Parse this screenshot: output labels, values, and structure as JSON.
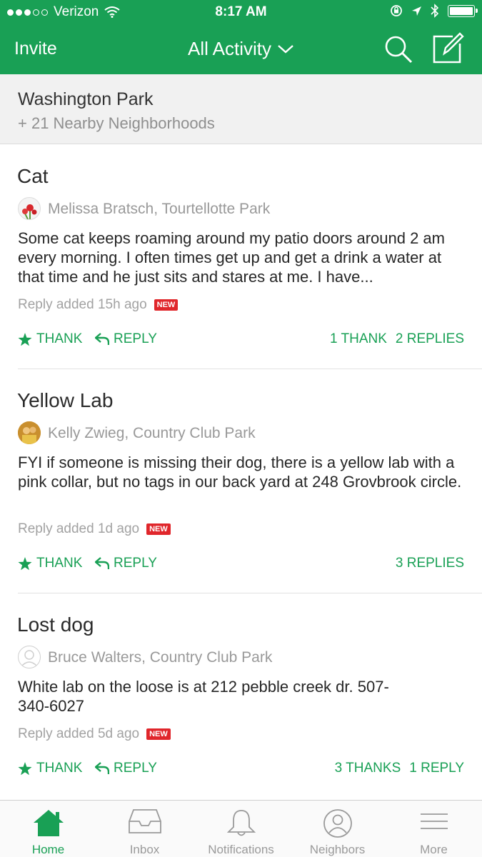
{
  "status_bar": {
    "carrier": "Verizon",
    "time": "8:17 AM",
    "battery_level": 1.0
  },
  "nav": {
    "invite_label": "Invite",
    "title": "All Activity",
    "search_icon": "search-icon",
    "compose_icon": "compose-icon"
  },
  "neighborhood": {
    "name": "Washington Park",
    "nearby": "+ 21 Nearby Neighborhoods"
  },
  "posts": [
    {
      "title": "Cat",
      "author": "Melissa Bratsch, Tourtellotte Park",
      "body": "Some cat keeps roaming around my patio doors around 2 am every morning. I often times get up and get a drink a water at that time and he just sits and stares at me. I have...",
      "meta": "Reply added 15h ago",
      "badge": "NEW",
      "thank_label": "THANK",
      "reply_label": "REPLY",
      "thanks_count": "1 THANK",
      "replies_count": "2 REPLIES"
    },
    {
      "title": "Yellow Lab",
      "author": "Kelly Zwieg, Country Club Park",
      "body": "FYI if someone is missing their dog, there is a yellow lab with a pink collar, but no tags in our back yard at 248 Grovbrook circle.",
      "meta": "Reply added 1d ago",
      "badge": "NEW",
      "thank_label": "THANK",
      "reply_label": "REPLY",
      "thanks_count": "",
      "replies_count": "3 REPLIES"
    },
    {
      "title": "Lost dog",
      "author": "Bruce Walters, Country Club Park",
      "body": "White lab on the loose is at 212 pebble creek dr. 507-340-6027",
      "meta": "Reply added 5d ago",
      "badge": "NEW",
      "thank_label": "THANK",
      "reply_label": "REPLY",
      "thanks_count": "3 THANKS",
      "replies_count": "1 REPLY"
    }
  ],
  "tabs": [
    {
      "label": "Home",
      "icon": "home-icon",
      "active": true
    },
    {
      "label": "Inbox",
      "icon": "inbox-icon",
      "active": false
    },
    {
      "label": "Notifications",
      "icon": "bell-icon",
      "active": false
    },
    {
      "label": "Neighbors",
      "icon": "neighbors-icon",
      "active": false
    },
    {
      "label": "More",
      "icon": "menu-icon",
      "active": false
    }
  ],
  "colors": {
    "brand_green": "#19a055",
    "badge_red": "#e0262b"
  }
}
